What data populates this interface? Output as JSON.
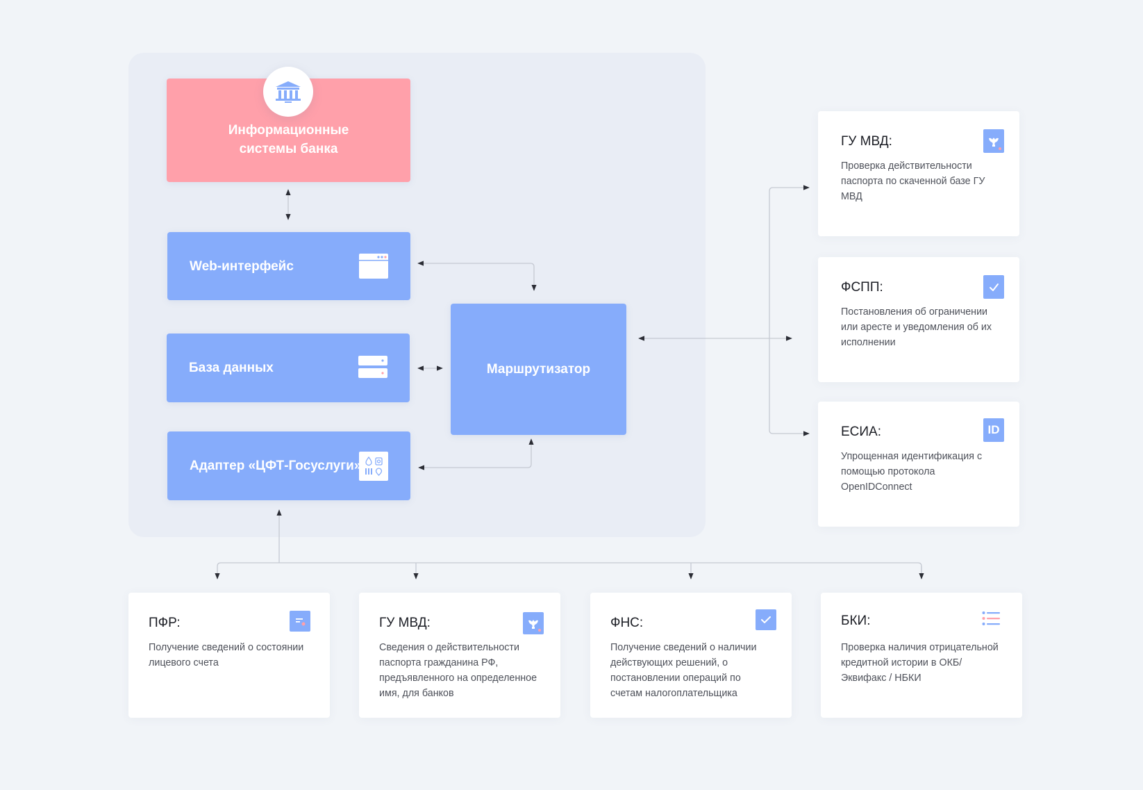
{
  "bank": {
    "title": "Информационные системы банка",
    "icon": "bank-building-icon"
  },
  "components": {
    "web": {
      "label": "Web-интерфейс",
      "icon": "browser-window-icon"
    },
    "db": {
      "label": "База данных",
      "icon": "server-icon"
    },
    "adapter": {
      "label": "Адаптер «ЦФТ-Госуслуги»",
      "icon": "services-grid-icon"
    },
    "router": {
      "label": "Маршрутизатор"
    }
  },
  "right_services": [
    {
      "title": "ГУ МВД:",
      "desc": "Проверка действительности паспорта по скаченной базе ГУ МВД",
      "icon": "emblem-icon"
    },
    {
      "title": "ФСПП:",
      "desc": "Постановления об ограничении или аресте и уведомления об их исполнении",
      "icon": "checkmark-icon"
    },
    {
      "title": "ЕСИА:",
      "desc": "Упрощенная идентификация с помощью протокола OpenIDConnect",
      "icon": "id-badge-icon",
      "icon_text": "ID"
    }
  ],
  "bottom_services": [
    {
      "title": "ПФР:",
      "desc": "Получение сведений о состоянии лицевого счета",
      "icon": "document-icon"
    },
    {
      "title": "ГУ МВД:",
      "desc": "Сведения о действительности паспорта гражданина РФ, предъявленного на определенное имя, для банков",
      "icon": "emblem-icon"
    },
    {
      "title": "ФНС:",
      "desc": "Получение сведений о наличии действующих решений, о постановлении операций по счетам налогоплательщика",
      "icon": "checkmark-icon"
    },
    {
      "title": "БКИ:",
      "desc": "Проверка наличия отрицательной кредитной истории в ОКБ/ Эквифакс / НБКИ",
      "icon": "list-icon"
    }
  ],
  "colors": {
    "background": "#f1f4f8",
    "panel": "#e9edf5",
    "blue": "#86acfb",
    "pink": "#ffa0aa",
    "connector": "#c5c9d2",
    "arrowhead": "#2b2d35"
  }
}
